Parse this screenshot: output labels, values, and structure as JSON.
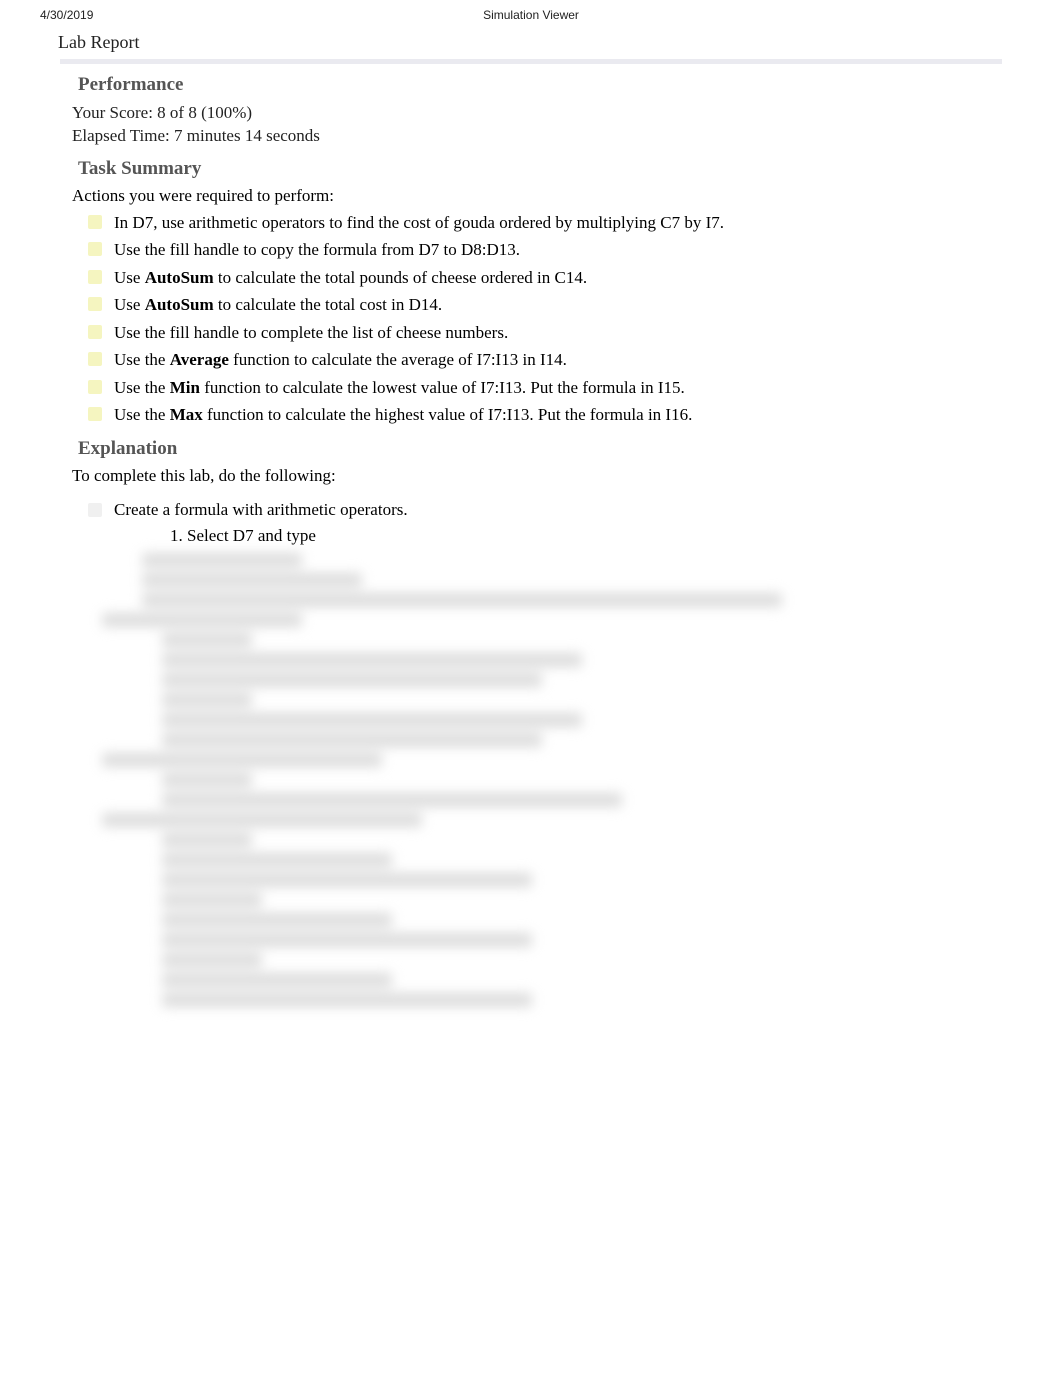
{
  "header": {
    "date": "4/30/2019",
    "title": "Simulation Viewer"
  },
  "lab_report_label": "Lab Report",
  "performance": {
    "heading": "Performance",
    "score_prefix": "Your Score: ",
    "score_value": "8 of 8 (100%)",
    "elapsed_prefix": "Elapsed Time: ",
    "elapsed_value": "7 minutes 14 seconds"
  },
  "task_summary": {
    "heading": "Task Summary",
    "intro": "Actions you were required to perform:",
    "items": [
      {
        "text": "In D7, use arithmetic operators to find the cost of gouda ordered by multiplying C7 by I7."
      },
      {
        "text": "Use the fill handle to copy the formula from D7 to D8:D13."
      },
      {
        "prefix": "Use ",
        "bold": "AutoSum",
        "suffix": " to calculate the total pounds of cheese ordered in C14."
      },
      {
        "prefix": "Use ",
        "bold": "AutoSum",
        "suffix": " to calculate the total cost in D14."
      },
      {
        "text": "Use the fill handle to complete the list of cheese numbers."
      },
      {
        "prefix": "Use the ",
        "bold": "Average",
        "suffix": " function to calculate the average of I7:I13 in I14."
      },
      {
        "prefix": "Use the ",
        "bold": "Min",
        "suffix": " function to calculate the lowest value of I7:I13. Put the formula in I15."
      },
      {
        "prefix": "Use the ",
        "bold": "Max",
        "suffix": " function to calculate the highest value of I7:I13. Put the formula in I16."
      }
    ]
  },
  "explanation": {
    "heading": "Explanation",
    "intro": "To complete this lab, do the following:",
    "step1_text": "Create a formula with arithmetic operators.",
    "step1_sub1": "1. Select D7 and type"
  }
}
